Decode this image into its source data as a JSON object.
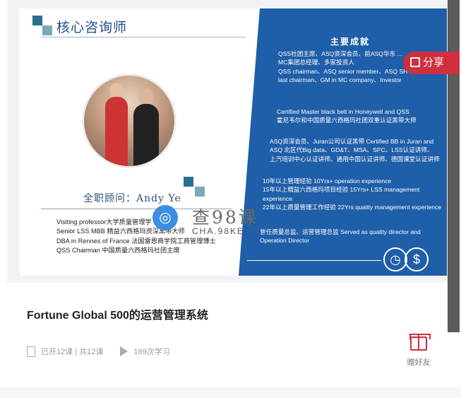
{
  "slide": {
    "title": "核心咨询师",
    "consultant_label": "全职顾问：Andy Ye",
    "left_lines": [
      "Visiting professor大学质量管理学 ...",
      "Senior LSS MBB 精益六西格玛资深黑带大师",
      "DBA in Rennes of France 法国雷恩商学院工商管理博士",
      "QSS Chairman 中国质量六西格玛社团主席"
    ],
    "right_heading": "主要成就",
    "right_blocks": [
      [
        "QSS社团主席、ASQ资深会员、前ASQ华东 ...",
        "MC集团总经理、多家投资人",
        "QSS chairman、ASQ senior member、ASQ SH LMC",
        "last chairman、GM in MC company、Investor"
      ],
      [
        "Certified Master black belt in Honeywell and QSS",
        "霍尼韦尔和中国质量六西格玛社团双重认证黑带大师"
      ],
      [
        "ASQ资深会员、Juran公司认证黑带 Certified BB in Juran and",
        "ASQ 北区代Big data、GD&T、MSA、SPC、LSS认证讲师、",
        "上汽培训中心认证讲师、通用中国认证讲师、德国课堂认证讲师"
      ],
      [
        "10年以上管理经验 10Yrs+ operation experience",
        "15年以上精益六西格玛项目经验 15Yrs+ LSS management",
        "experience",
        "22年以上质量管理工作经验 22Yrs quality management experience"
      ],
      [
        "曾任质量总监、运营管理总监 Served as quality director and",
        "Operation Director"
      ]
    ]
  },
  "watermark": {
    "title": "查98课",
    "subtitle": "CHA.98KE.C..."
  },
  "share": {
    "label": "分享"
  },
  "course": {
    "title": "Fortune Global 500的运营管理系统",
    "lessons": "已开12课 | 共12课",
    "views": "169次学习"
  },
  "gift": {
    "label": "赠好友"
  },
  "colors": {
    "accent": "#cf2f3e",
    "panel": "#1f5ea8"
  }
}
